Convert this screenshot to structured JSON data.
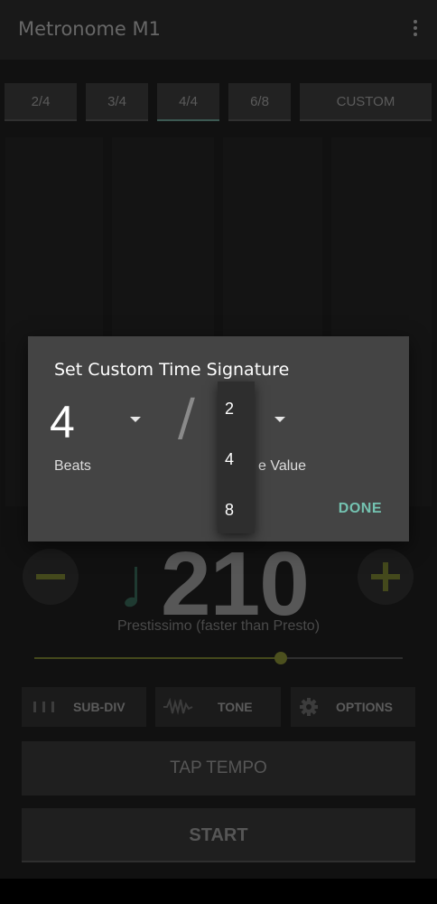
{
  "app": {
    "title": "Metronome M1"
  },
  "tabs": [
    {
      "label": "2/4",
      "selected": false
    },
    {
      "label": "3/4",
      "selected": false
    },
    {
      "label": "4/4",
      "selected": true
    },
    {
      "label": "6/8",
      "selected": false
    },
    {
      "label": "CUSTOM",
      "selected": false
    }
  ],
  "tempo": {
    "bpm": "210",
    "name": "Prestissimo (faster than Presto)",
    "slider_fraction": 0.67
  },
  "options": {
    "subdiv_label": "SUB-DIV",
    "tone_label": "TONE",
    "options_label": "OPTIONS"
  },
  "buttons": {
    "tap_tempo": "TAP TEMPO",
    "start": "START"
  },
  "dialog": {
    "title": "Set Custom Time Signature",
    "beats_value": "4",
    "beats_label": "Beats",
    "slash": "/",
    "note_value_label_visible": "e Value",
    "done_label": "DONE"
  },
  "note_value_dropdown": {
    "options": [
      "2",
      "4",
      "8"
    ]
  },
  "colors": {
    "accent_teal": "#74c3b1",
    "accent_olive": "#545a23",
    "dialog_bg": "#444444"
  }
}
